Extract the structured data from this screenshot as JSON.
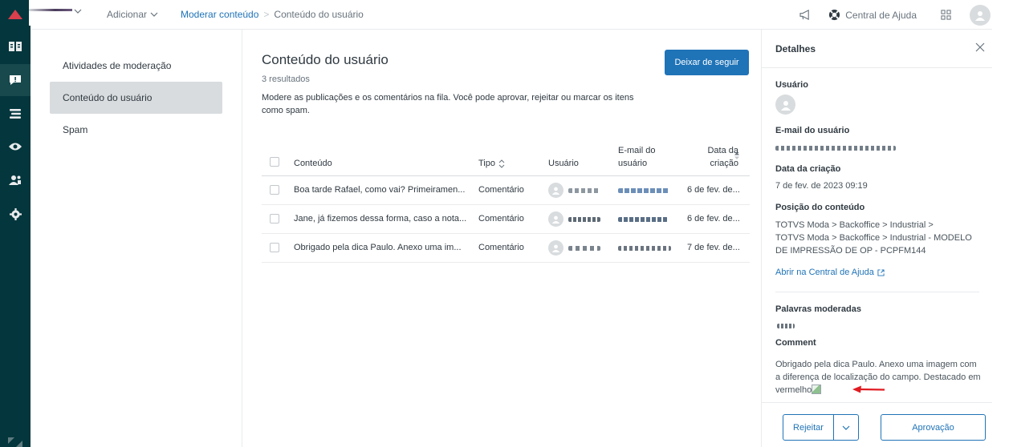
{
  "header": {
    "add_label": "Adicionar",
    "breadcrumb_link": "Moderar conteúdo",
    "breadcrumb_sep": ">",
    "breadcrumb_current": "Conteúdo do usuário",
    "help_label": "Central de Ajuda"
  },
  "rail": {
    "icons": [
      "zendesk-logo-icon",
      "knowledge-icon",
      "moderation-icon",
      "arrange-icon",
      "eye-icon",
      "users-icon",
      "settings-icon"
    ],
    "active_index": 1,
    "accent": "#d93f4c"
  },
  "subnav": {
    "items": [
      {
        "label": "Atividades de moderação",
        "active": false
      },
      {
        "label": "Conteúdo do usuário",
        "active": true
      },
      {
        "label": "Spam",
        "active": false
      }
    ]
  },
  "main": {
    "title": "Conteúdo do usuário",
    "results": "3 resultados",
    "description": "Modere as publicações e os comentários na fila. Você pode aprovar, rejeitar ou marcar os itens como spam.",
    "follow_button": "Deixar de seguir",
    "columns": {
      "content": "Conteúdo",
      "type": "Tipo",
      "user": "Usuário",
      "email_l1": "E-mail do",
      "email_l2": "usuário",
      "date_l1": "Data da",
      "date_l2": "criação"
    },
    "rows": [
      {
        "content": "Boa tarde Rafael, como vai? Primeiramen...",
        "type": "Comentário",
        "date": "6 de fev. de..."
      },
      {
        "content": "Jane, já fizemos dessa forma, caso a nota...",
        "type": "Comentário",
        "date": "6 de fev. de..."
      },
      {
        "content": "Obrigado pela dica Paulo. Anexo uma im...",
        "type": "Comentário",
        "date": "7 de fev. de..."
      }
    ]
  },
  "details": {
    "title": "Detalhes",
    "user_label": "Usuário",
    "email_label": "E-mail do usuário",
    "created_label": "Data da criação",
    "created_value": "7 de fev. de 2023 09:19",
    "position_label": "Posição do conteúdo",
    "position_l1": "TOTVS Moda > Backoffice > Industrial >",
    "position_l2": "TOTVS Moda > Backoffice > Industrial - MODELO DE IMPRESSÃO DE OP - PCPFM144",
    "help_link": "Abrir na Central de Ajuda",
    "words_label": "Palavras moderadas",
    "comment_label": "Comment",
    "comment_text": "Obrigado pela dica Paulo. Anexo uma imagem com a diferença de localização do campo. Destacado em vermelho",
    "reject_button": "Rejeitar",
    "approve_button": "Aprovação"
  }
}
